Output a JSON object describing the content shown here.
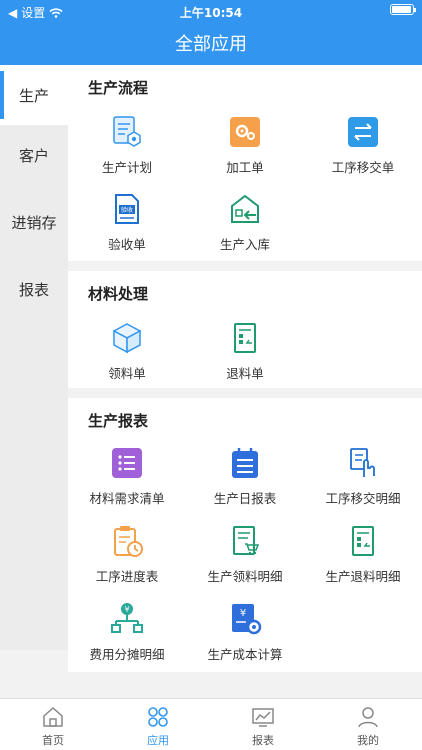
{
  "status": {
    "carrier": "设置",
    "time": "上午10:54"
  },
  "title": "全部应用",
  "sidebar": [
    {
      "label": "生产"
    },
    {
      "label": "客户"
    },
    {
      "label": "进销存"
    },
    {
      "label": "报表"
    }
  ],
  "sections": [
    {
      "title": "生产流程",
      "items": [
        "生产计划",
        "加工单",
        "工序移交单",
        "验收单",
        "生产入库"
      ]
    },
    {
      "title": "材料处理",
      "items": [
        "领料单",
        "退料单"
      ]
    },
    {
      "title": "生产报表",
      "items": [
        "材料需求清单",
        "生产日报表",
        "工序移交明细",
        "工序进度表",
        "生产领料明细",
        "生产退料明细",
        "费用分摊明细",
        "生产成本计算"
      ]
    }
  ],
  "bottom_nav": [
    {
      "label": "首页"
    },
    {
      "label": "应用"
    },
    {
      "label": "报表"
    },
    {
      "label": "我的"
    }
  ],
  "icons": {
    "plan": "plan-doc-icon",
    "process": "gear-order-icon",
    "transfer": "transfer-arrows-icon",
    "inspect": "inspection-doc-icon",
    "warehouse": "warehouse-in-icon",
    "pick": "box-icon",
    "return": "return-doc-icon",
    "req": "list-icon",
    "daily": "calendar-icon",
    "transfer_detail": "hand-doc-icon",
    "progress": "clipboard-clock-icon",
    "pick_detail": "doc-cart-icon",
    "return_detail": "doc-return-icon",
    "cost_alloc": "org-tree-icon",
    "cost_calc": "yen-gear-icon"
  },
  "colors": {
    "primary": "#3296f0",
    "orange": "#f5a04a",
    "purple": "#a060d8",
    "green": "#1f9b6e",
    "teal": "#2aa89a"
  }
}
